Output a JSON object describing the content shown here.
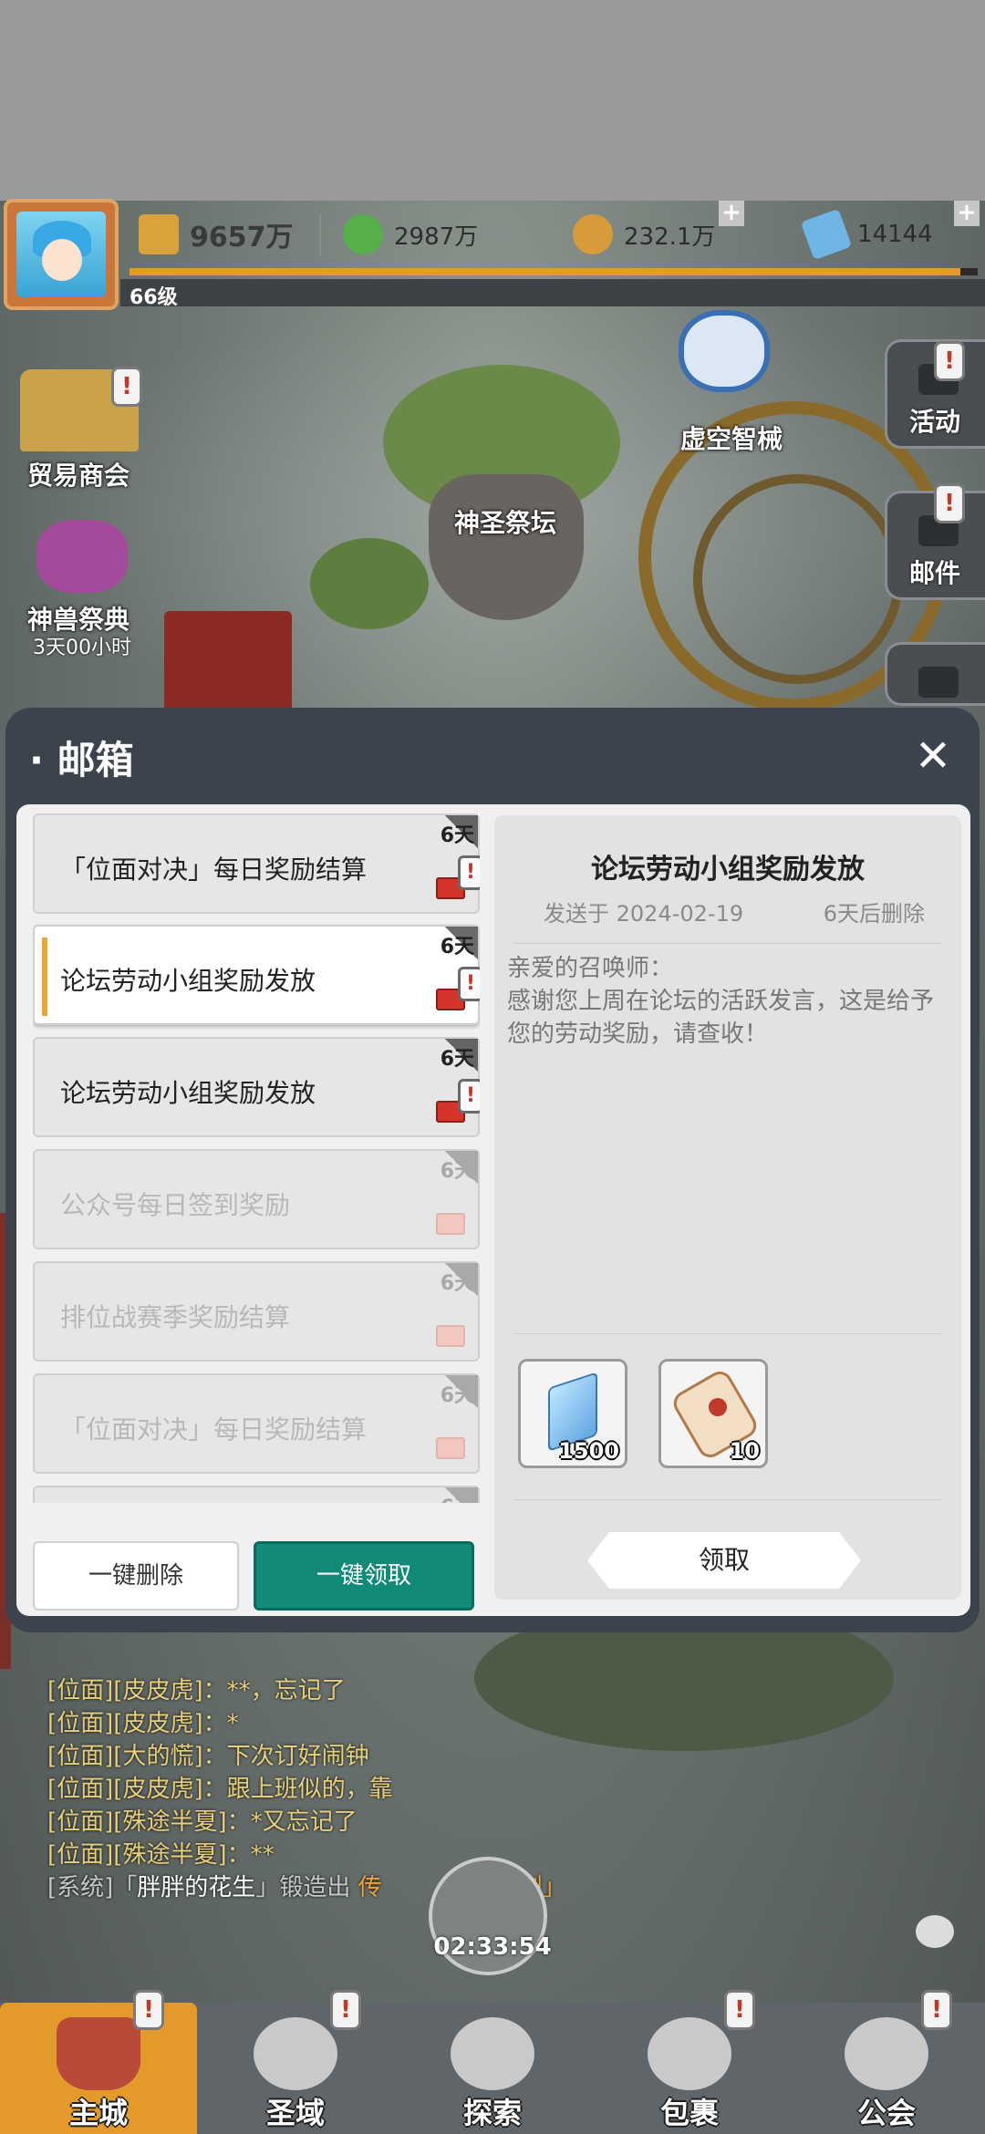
{
  "hud": {
    "power": "9657万",
    "gold": "2987万",
    "coins": "232.1万",
    "gems": "14144",
    "level": "66级",
    "exp_progress": 0.98
  },
  "map": {
    "trade": "贸易商会",
    "beast_festival": "神兽祭典",
    "beast_timer": "3天00小时",
    "altar": "神圣祭坛",
    "mech": "虚空智械"
  },
  "side_menu": {
    "activity": "活动",
    "mail": "邮件"
  },
  "mailbox": {
    "title": "邮箱",
    "close_icon": "close-icon",
    "items": [
      {
        "subject": "「位面对决」每日奖励结算",
        "days": "6天",
        "state": "unread"
      },
      {
        "subject": "论坛劳动小组奖励发放",
        "days": "6天",
        "state": "selected"
      },
      {
        "subject": "论坛劳动小组奖励发放",
        "days": "6天",
        "state": "unread"
      },
      {
        "subject": "公众号每日签到奖励",
        "days": "6天",
        "state": "read"
      },
      {
        "subject": "排位战赛季奖励结算",
        "days": "6天",
        "state": "read"
      },
      {
        "subject": "「位面对决」每日奖励结算",
        "days": "6天",
        "state": "read"
      },
      {
        "subject": "",
        "days": "6天",
        "state": "read"
      }
    ],
    "delete_all": "一键删除",
    "claim_all": "一键领取",
    "detail": {
      "title": "论坛劳动小组奖励发放",
      "sent": "发送于 2024-02-19",
      "expires": "6天后删除",
      "greeting": "亲爱的召唤师：",
      "body": "感谢您上周在论坛的活跃发言，这是给予您的劳动奖励，请查收！",
      "rewards": [
        {
          "icon": "diamond-icon",
          "count": "1500"
        },
        {
          "icon": "scroll-icon",
          "count": "10"
        }
      ],
      "claim": "领取"
    }
  },
  "chat": [
    {
      "prefix": "[位面][",
      "name": "皮皮虎",
      "suffix": "]：**，忘记了"
    },
    {
      "prefix": "[位面][",
      "name": "皮皮虎",
      "suffix": "]：*"
    },
    {
      "prefix": "[位面][",
      "name": "大的慌",
      "suffix": "]：下次订好闹钟"
    },
    {
      "prefix": "[位面][",
      "name": "皮皮虎",
      "suffix": "]：跟上班似的，靠"
    },
    {
      "prefix": "[位面][",
      "name": "殊途半夏",
      "suffix": "]：*又忘记了"
    },
    {
      "prefix": "[位面][",
      "name": "殊途半夏",
      "suffix": "]：**"
    }
  ],
  "system_msg": {
    "prefix": "[系统]「",
    "name": "胖胖的花生",
    "mid": "」锻造出 ",
    "item": "传",
    "item_tail": "剑」"
  },
  "timer": "02:33:54",
  "nav": [
    "主城",
    "圣域",
    "探索",
    "包裹",
    "公会"
  ]
}
